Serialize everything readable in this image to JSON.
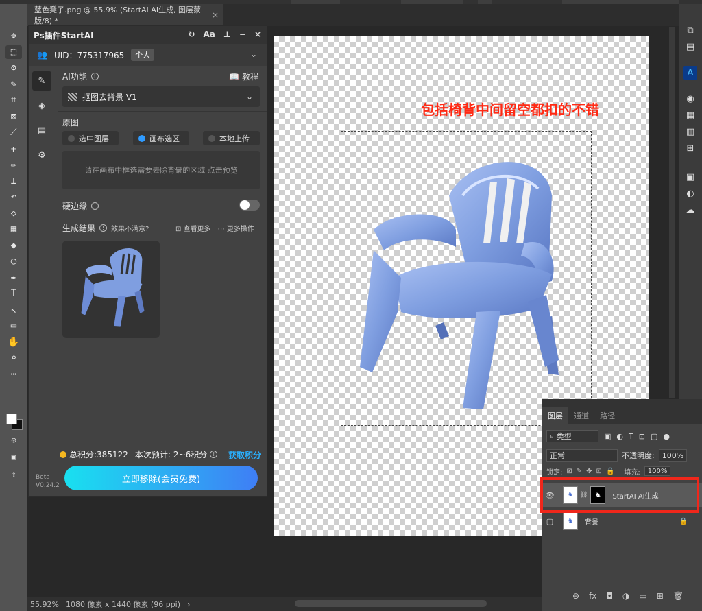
{
  "document": {
    "tab_title": "蓝色凳子.png @ 55.9% (StartAI AI生成, 图层蒙版/8) *",
    "tab_close": "×"
  },
  "toolbar": {
    "tools": [
      "move",
      "marquee",
      "lasso",
      "quick-select",
      "crop",
      "frame",
      "eyedropper",
      "healing",
      "brush",
      "stamp",
      "history-brush",
      "eraser",
      "gradient",
      "blur",
      "dodge",
      "pen",
      "type",
      "path-select",
      "rectangle",
      "hand",
      "zoom",
      "more"
    ],
    "icons": [
      "✥",
      "⬚",
      "ʘ",
      "✎",
      "⌗",
      "⊠",
      "⟋",
      "✚",
      "✏",
      "⊥",
      "↶",
      "◇",
      "▦",
      "◆",
      "○",
      "✒",
      "T",
      "↖",
      "▭",
      "✋",
      "⌕",
      "⋯"
    ]
  },
  "plugin": {
    "title": "Ps插件StartAI",
    "head_icons": {
      "refresh": "↻",
      "font": "Aa",
      "pin": "⊥",
      "minimize": "−",
      "close": "×"
    },
    "uid_label": "UID：775317965",
    "account_badge": "个人",
    "ai_function_label": "AI功能",
    "tutorial_label": "教程",
    "function_select": "抠图去背景 V1",
    "original_label": "原图",
    "source_options": [
      "选中图层",
      "画布选区",
      "本地上传"
    ],
    "source_selected": 1,
    "hint_text": "请在画布中框选需要去除背景的区域 点击预览",
    "hard_edge_label": "硬边缘",
    "hard_edge_on": false,
    "result_label": "生成结果",
    "unsatisfied_label": "效果不满意?",
    "view_more": "查看更多",
    "more_actions": "更多操作",
    "points_text": "总积分:385122",
    "estimate_label": "本次预计:",
    "estimate_value": "2~6积分",
    "earn_points": "获取积分",
    "cta_label": "立即移除(会员免费)",
    "beta_label": "Beta",
    "version": "V0.24.2"
  },
  "canvas": {
    "annotation": "包括椅背中间留空都扣的不错",
    "annotation_color": "#ff2a14"
  },
  "layers_panel": {
    "tabs": [
      "图层",
      "通道",
      "路径"
    ],
    "active_tab": 0,
    "filter_label": "类型",
    "blend_mode": "正常",
    "opacity_label": "不透明度:",
    "opacity_value": "100%",
    "lock_label": "锁定:",
    "fill_label": "填充:",
    "fill_value": "100%",
    "layers": [
      {
        "name": "StartAI AI生成",
        "visible": true,
        "selected": true,
        "has_mask": true
      },
      {
        "name": "背景",
        "visible": false,
        "selected": false,
        "locked": true
      }
    ]
  },
  "status_bar": {
    "zoom": "55.92%",
    "doc_info": "1080 像素 x 1440 像素 (96 ppi)"
  },
  "colors": {
    "accent_blue": "#2f9bff",
    "highlight_red": "#f0271b",
    "cta_start": "#19e0f0",
    "cta_end": "#3f7ef5",
    "chair_blue": "#7f9ee0"
  }
}
